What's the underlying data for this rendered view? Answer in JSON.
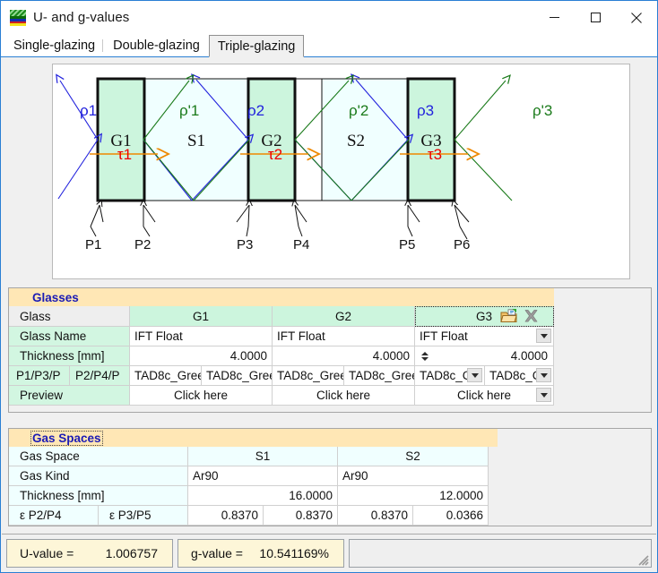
{
  "window": {
    "title": "U- and g-values",
    "icon": "app-glazing-icon",
    "buttons": {
      "minimize": "—",
      "maximize": "☐",
      "close": "✕"
    }
  },
  "tabs": [
    {
      "label": "Single-glazing",
      "active": false
    },
    {
      "label": "Double-glazing",
      "active": false
    },
    {
      "label": "Triple-glazing",
      "active": true
    }
  ],
  "diagram": {
    "glass_layers": [
      {
        "label": "G1"
      },
      {
        "label": "G2"
      },
      {
        "label": "G3"
      }
    ],
    "gas_spaces": [
      {
        "label": "S1"
      },
      {
        "label": "S2"
      }
    ],
    "reflection_labels": [
      {
        "label": "ρ1",
        "color": "#2222dd"
      },
      {
        "label": "ρ'1",
        "color": "#1a7a1a"
      },
      {
        "label": "ρ2",
        "color": "#2222dd"
      },
      {
        "label": "ρ'2",
        "color": "#1a7a1a"
      },
      {
        "label": "ρ3",
        "color": "#2222dd"
      },
      {
        "label": "ρ'3",
        "color": "#1a7a1a"
      }
    ],
    "transmission_labels": [
      {
        "label": "τ1",
        "color": "#ee0000"
      },
      {
        "label": "τ2",
        "color": "#ee0000"
      },
      {
        "label": "τ3",
        "color": "#ee0000"
      }
    ],
    "surface_labels": [
      "P1",
      "P2",
      "P3",
      "P4",
      "P5",
      "P6"
    ],
    "colors": {
      "glass_fill": "#ccf5dd",
      "gas_fill": "#f0ffff",
      "blue_ray": "#2222dd",
      "green_ray": "#1a7a1a",
      "orange_ray": "#ee8800",
      "tau_text": "#ee0000"
    }
  },
  "glasses_panel": {
    "title": "Glasses",
    "rows": {
      "glass": "Glass",
      "glass_name": "Glass Name",
      "thickness": "Thickness [mm]",
      "eps_left": "P1/P3/P",
      "eps_right": "P2/P4/P",
      "preview": "Preview"
    },
    "columns": [
      {
        "header": "G1",
        "selected": false,
        "glass_name": "IFT Float",
        "thickness": "4.0000",
        "eps_left": "TAD8c_Gree",
        "eps_right": "TAD8c_Gree",
        "preview": "Click here"
      },
      {
        "header": "G2",
        "selected": false,
        "glass_name": "IFT Float",
        "thickness": "4.0000",
        "eps_left": "TAD8c_Gree",
        "eps_right": "TAD8c_Gree",
        "preview": "Click here"
      },
      {
        "header": "G3",
        "selected": true,
        "glass_name": "IFT Float",
        "thickness": "4.0000",
        "eps_left": "TAD8c_C",
        "eps_right": "TAD8c_C",
        "preview": "Click here"
      }
    ],
    "icons": {
      "open": "folder-open-icon",
      "delete": "delete-x-icon"
    }
  },
  "gas_panel": {
    "title": "Gas Spaces",
    "rows": {
      "gas_space": "Gas Space",
      "gas_kind": "Gas Kind",
      "thickness": "Thickness [mm]",
      "eps_left": "ε P2/P4",
      "eps_right": "ε P3/P5"
    },
    "columns": [
      {
        "header": "S1",
        "gas_kind": "Ar90",
        "thickness": "16.0000",
        "eps_left": "0.8370",
        "eps_right": "0.8370"
      },
      {
        "header": "S2",
        "gas_kind": "Ar90",
        "thickness": "12.0000",
        "eps_left": "0.8370",
        "eps_right": "0.0366"
      }
    ]
  },
  "statusbar": {
    "u_label": "U-value  =",
    "u_value": "1.006757",
    "g_label": "g-value  =",
    "g_value": "10.541169%"
  }
}
